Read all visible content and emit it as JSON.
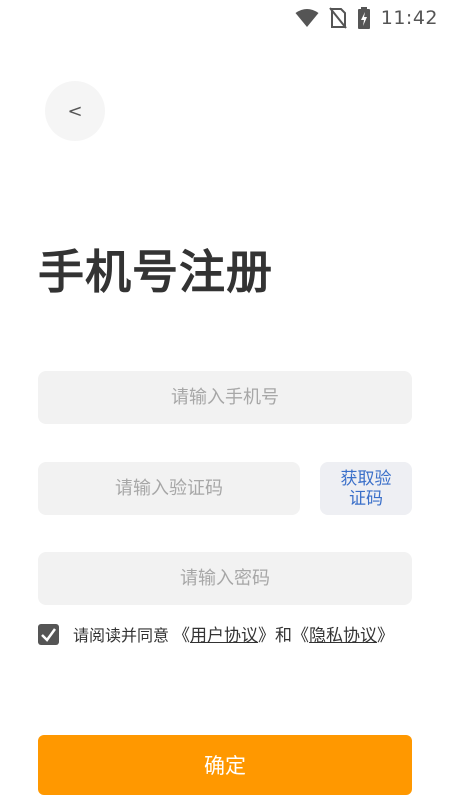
{
  "status_bar": {
    "time": "11:42",
    "icons": [
      "wifi-icon",
      "no-sim-icon",
      "battery-charging-icon"
    ]
  },
  "back_button": {
    "label": "<"
  },
  "page_title": "手机号注册",
  "phone_field": {
    "placeholder": "请输入手机号",
    "value": ""
  },
  "code_field": {
    "placeholder": "请输入验证码",
    "value": ""
  },
  "get_code_button": {
    "label": "获取验证码"
  },
  "password_field": {
    "placeholder": "请输入密码",
    "value": ""
  },
  "agreement": {
    "checked": true,
    "lead_text": "请阅读并同意",
    "open_quote_1": "《",
    "user_agreement_link": "用户协议",
    "close_quote_1": "》",
    "and_text": "和",
    "open_quote_2": "《",
    "privacy_link": "隐私协议",
    "close_quote_2": "》"
  },
  "confirm_button": {
    "label": "确定"
  },
  "colors": {
    "accent": "#ff9800",
    "link_blue": "#3a6fc9",
    "field_bg": "#f2f2f2",
    "title_text": "#333333",
    "placeholder": "#a7a7a7"
  }
}
